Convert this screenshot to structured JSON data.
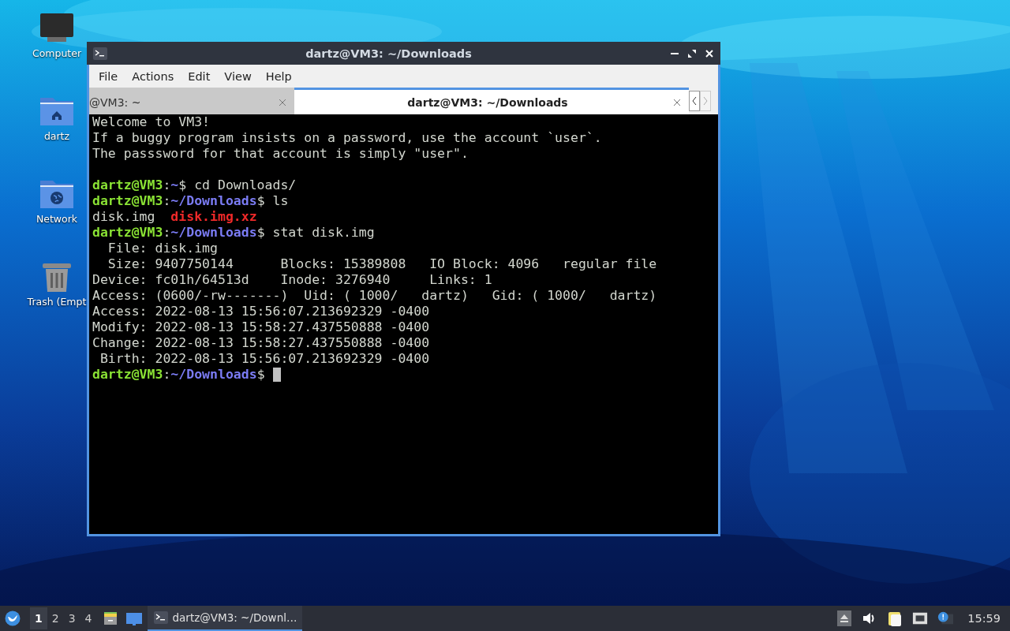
{
  "desktop": {
    "icons": [
      {
        "kind": "computer",
        "label": "Computer"
      },
      {
        "kind": "home",
        "label": "dartz"
      },
      {
        "kind": "network",
        "label": "Network"
      },
      {
        "kind": "trash",
        "label": "Trash (Empt"
      }
    ]
  },
  "window": {
    "title": "dartz@VM3: ~/Downloads",
    "menu": [
      "File",
      "Actions",
      "Edit",
      "View",
      "Help"
    ],
    "tabs": [
      {
        "label": "@VM3: ~",
        "selected": false
      },
      {
        "label": "dartz@VM3: ~/Downloads",
        "selected": true
      }
    ],
    "terminal": {
      "lines": [
        {
          "segments": [
            {
              "kind": "text",
              "text": "Welcome to VM3!"
            }
          ]
        },
        {
          "segments": [
            {
              "kind": "text",
              "text": "If a buggy program insists on a password, use the account `user`."
            }
          ]
        },
        {
          "segments": [
            {
              "kind": "text",
              "text": "The passsword for that account is simply \"user\"."
            }
          ]
        },
        {
          "blank_before": true,
          "segments": [
            {
              "kind": "user",
              "text": "dartz@VM3"
            },
            {
              "kind": "text",
              "text": ":"
            },
            {
              "kind": "path",
              "text": "~"
            },
            {
              "kind": "text",
              "text": "$ cd Downloads/"
            }
          ]
        },
        {
          "segments": [
            {
              "kind": "user",
              "text": "dartz@VM3"
            },
            {
              "kind": "text",
              "text": ":"
            },
            {
              "kind": "path",
              "text": "~/Downloads"
            },
            {
              "kind": "text",
              "text": "$ ls"
            }
          ]
        },
        {
          "segments": [
            {
              "kind": "text",
              "text": "disk.img  "
            },
            {
              "kind": "archive",
              "text": "disk.img.xz"
            }
          ]
        },
        {
          "segments": [
            {
              "kind": "user",
              "text": "dartz@VM3"
            },
            {
              "kind": "text",
              "text": ":"
            },
            {
              "kind": "path",
              "text": "~/Downloads"
            },
            {
              "kind": "text",
              "text": "$ stat disk.img"
            }
          ]
        },
        {
          "segments": [
            {
              "kind": "text",
              "text": "  File: disk.img"
            }
          ]
        },
        {
          "segments": [
            {
              "kind": "text",
              "text": "  Size: 9407750144      Blocks: 15389808   IO Block: 4096   regular file"
            }
          ]
        },
        {
          "segments": [
            {
              "kind": "text",
              "text": "Device: fc01h/64513d    Inode: 3276940     Links: 1"
            }
          ]
        },
        {
          "segments": [
            {
              "kind": "text",
              "text": "Access: (0600/-rw-------)  Uid: ( 1000/   dartz)   Gid: ( 1000/   dartz)"
            }
          ]
        },
        {
          "segments": [
            {
              "kind": "text",
              "text": "Access: 2022-08-13 15:56:07.213692329 -0400"
            }
          ]
        },
        {
          "segments": [
            {
              "kind": "text",
              "text": "Modify: 2022-08-13 15:58:27.437550888 -0400"
            }
          ]
        },
        {
          "segments": [
            {
              "kind": "text",
              "text": "Change: 2022-08-13 15:58:27.437550888 -0400"
            }
          ]
        },
        {
          "segments": [
            {
              "kind": "text",
              "text": " Birth: 2022-08-13 15:56:07.213692329 -0400"
            }
          ]
        },
        {
          "segments": [
            {
              "kind": "user",
              "text": "dartz@VM3"
            },
            {
              "kind": "text",
              "text": ":"
            },
            {
              "kind": "path",
              "text": "~/Downloads"
            },
            {
              "kind": "text",
              "text": "$ "
            }
          ],
          "cursor": true
        }
      ]
    }
  },
  "taskbar": {
    "workspaces": [
      {
        "label": "1",
        "selected": true
      },
      {
        "label": "2",
        "selected": false
      },
      {
        "label": "3",
        "selected": false
      },
      {
        "label": "4",
        "selected": false
      }
    ],
    "tasks": [
      {
        "label": "dartz@VM3: ~/Downl…",
        "selected": true
      }
    ],
    "clock": "15:59"
  }
}
